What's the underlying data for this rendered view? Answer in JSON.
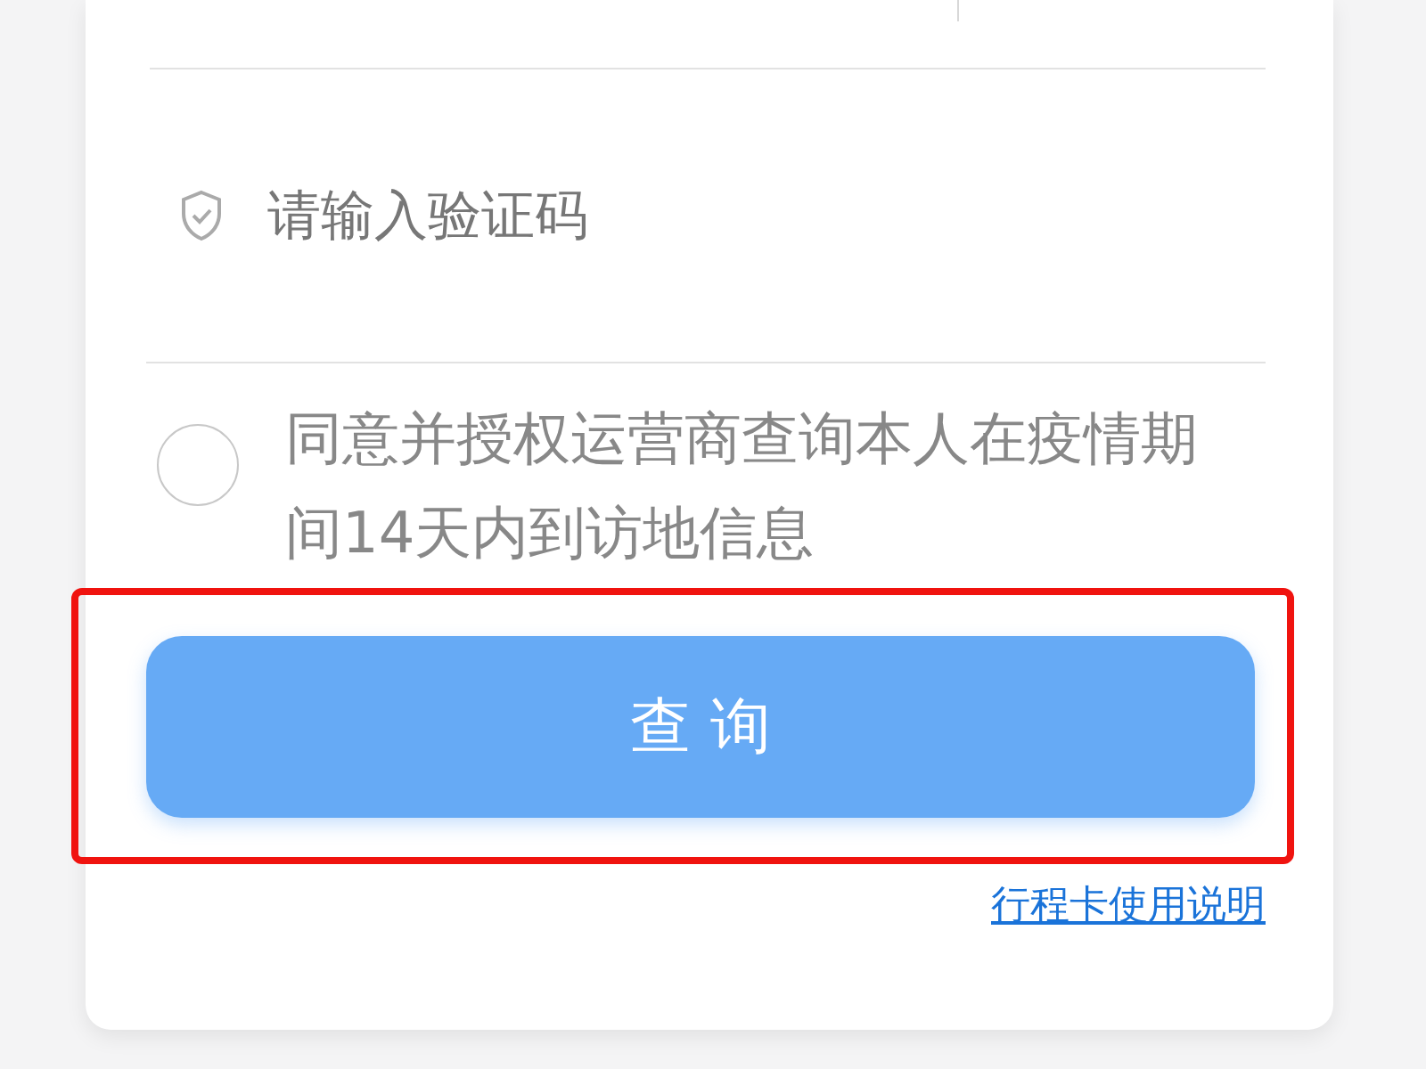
{
  "code_field": {
    "placeholder": "请输入验证码"
  },
  "consent": {
    "text": "同意并授权运营商查询本人在疫情期间14天内到访地信息",
    "checked": false
  },
  "query_button": {
    "label": "查 询"
  },
  "guide_link": {
    "label": "行程卡使用说明"
  }
}
